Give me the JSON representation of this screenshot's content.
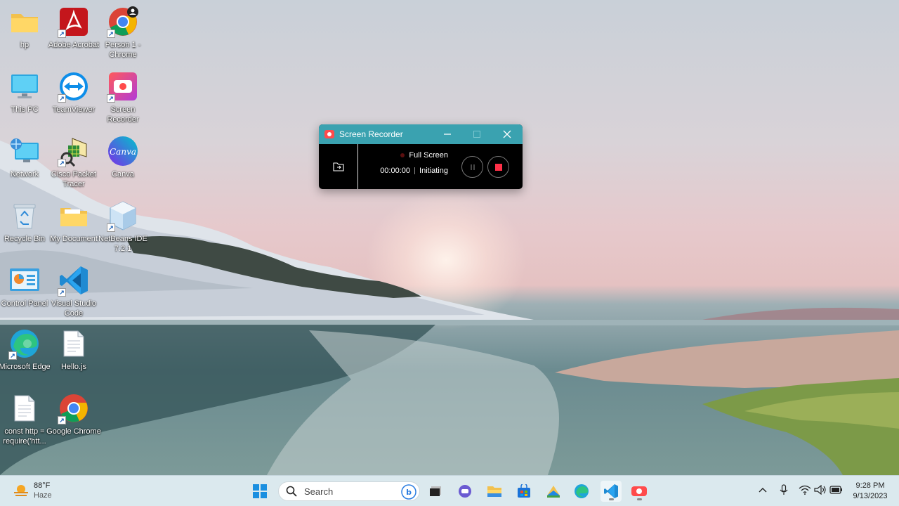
{
  "desktop": {
    "icons": [
      {
        "label": "hp",
        "icon": "folder-icon"
      },
      {
        "label": "Adobe Acrobat",
        "icon": "acrobat-icon"
      },
      {
        "label": "Person 1 - Chrome",
        "icon": "chrome-profile-icon"
      },
      {
        "label": "This PC",
        "icon": "monitor-icon"
      },
      {
        "label": "TeamViewer",
        "icon": "teamviewer-icon"
      },
      {
        "label": "Screen Recorder",
        "icon": "screen-recorder-icon"
      },
      {
        "label": "Network",
        "icon": "network-icon"
      },
      {
        "label": "Cisco Packet Tracer",
        "icon": "packet-tracer-icon"
      },
      {
        "label": "Canva",
        "icon": "canva-icon"
      },
      {
        "label": "Recycle Bin",
        "icon": "recycle-bin-icon"
      },
      {
        "label": "My Document",
        "icon": "folder-icon"
      },
      {
        "label": "NetBeans IDE 7.2.1",
        "icon": "netbeans-icon"
      },
      {
        "label": "Control Panel",
        "icon": "control-panel-icon"
      },
      {
        "label": "Visual Studio Code",
        "icon": "vscode-icon"
      },
      {
        "label": "Microsoft Edge",
        "icon": "edge-icon"
      },
      {
        "label": "Hello.js",
        "icon": "file-icon"
      },
      {
        "label": "const http = require('htt...",
        "icon": "file-icon"
      },
      {
        "label": "Google Chrome",
        "icon": "chrome-icon"
      }
    ]
  },
  "recorder": {
    "title": "Screen Recorder",
    "mode": "Full Screen",
    "time": "00:00:00",
    "status": "Initiating",
    "accent": "#3aa2b0"
  },
  "taskbar": {
    "weather_temp": "88°F",
    "weather_cond": "Haze",
    "search_placeholder": "Search",
    "time": "9:28 PM",
    "date": "9/13/2023",
    "apps": [
      "start-icon",
      "file-explorer-icon",
      "teams-chat-icon",
      "folder-icon",
      "store-icon",
      "app-icon",
      "edge-icon",
      "vscode-icon",
      "screen-recorder-icon"
    ]
  }
}
